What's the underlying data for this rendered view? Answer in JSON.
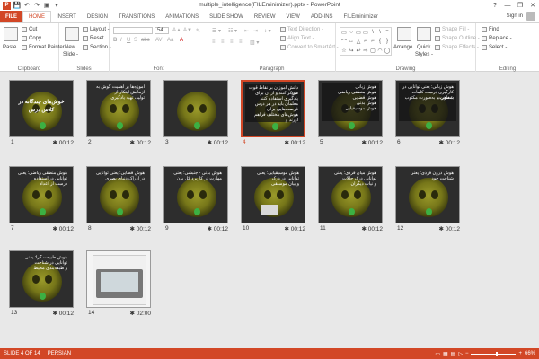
{
  "window": {
    "title": "multiple_intelligence(FILEminimizer).pptx - PowerPoint",
    "help": "?",
    "minimize": "—",
    "restore": "❐",
    "close": "✕"
  },
  "qat": {
    "logo": "P",
    "save": "💾",
    "undo": "↶",
    "redo": "↷",
    "start": "▣",
    "more": "▾"
  },
  "tabs": [
    "HOME",
    "INSERT",
    "DESIGN",
    "TRANSITIONS",
    "ANIMATIONS",
    "SLIDE SHOW",
    "REVIEW",
    "VIEW",
    "ADD-INS",
    "FILEminimizer"
  ],
  "file_tab": "FILE",
  "signin": "Sign in",
  "ribbon": {
    "clipboard": {
      "label": "Clipboard",
      "paste": "Paste",
      "cut": "Cut",
      "copy": "Copy",
      "format_painter": "Format Painter"
    },
    "slides": {
      "label": "Slides",
      "new_slide": "New",
      "new_slide2": "Slide -",
      "layout": "Layout -",
      "reset": "Reset",
      "section": "Section -"
    },
    "font": {
      "label": "Font",
      "size": "54",
      "bold": "B",
      "italic": "I",
      "underline": "U",
      "strike": "S",
      "shadow": "abc",
      "spacing": "AV",
      "case": "Aa",
      "color": "A"
    },
    "paragraph": {
      "label": "Paragraph",
      "text_direction": "Text Direction -",
      "align_text": "Align Text -",
      "convert_smartart": "Convert to SmartArt -"
    },
    "drawing": {
      "label": "Drawing",
      "arrange": "Arrange",
      "quick_styles": "Quick",
      "quick_styles2": "Styles -",
      "shape_fill": "Shape Fill -",
      "shape_outline": "Shape Outline -",
      "shape_effects": "Shape Effects -"
    },
    "editing": {
      "label": "Editing",
      "find": "Find",
      "replace": "Replace -",
      "select": "Select -"
    },
    "shapes": [
      "▭",
      "○",
      "▭",
      "▭",
      "\\",
      "\\",
      "⌒",
      "⌒",
      "↔",
      "△",
      "⌐",
      "⌐",
      "{",
      "}",
      "☆",
      "↪",
      "↩",
      "⇨",
      "▢",
      "◠",
      "◯"
    ]
  },
  "slides": [
    {
      "num": "1",
      "duration": "00:12",
      "lines": [
        "خوش‌های چندگانه در",
        "کلاس درس"
      ],
      "variant": "title"
    },
    {
      "num": "2",
      "duration": "00:12",
      "lines": [
        "آموزه‌ها بر اهمیت گوش به",
        "آزمایش ابتکار از",
        "تولید، تهیه یادگیری"
      ],
      "variant": "mask"
    },
    {
      "num": "3",
      "duration": "00:12",
      "lines": [],
      "variant": "mask"
    },
    {
      "num": "4",
      "duration": "00:12",
      "lines": [
        "دانش آموزان بر نقاط قوت خود",
        "تمرکز کنند و از آن برای",
        "یادگیری استفاده کنند",
        "معلمان باید در هر درس",
        "فرصت‌هایی برای",
        "هوش‌های مختلف فراهم",
        "آورند و"
      ],
      "variant": "text",
      "selected": true
    },
    {
      "num": "5",
      "duration": "00:12",
      "lines": [
        "هوش زبانی",
        "هوش منطقی ریاضی",
        "هوش فضایی",
        "هوش بدنی",
        "هوش موسیقیایی"
      ],
      "variant": "list"
    },
    {
      "num": "6",
      "duration": "00:12",
      "lines": [
        "هوش زبانی: یعنی توانایی در",
        "کارگیری درست کلمات به‌صورت",
        "شفاهی یا به‌صورت مکتوب"
      ],
      "variant": "def"
    },
    {
      "num": "7",
      "duration": "00:12",
      "lines": [
        "هوش منطقی ریاضی: یعنی",
        "توانایی در استفاده",
        "درست از اعداد"
      ],
      "variant": "mask"
    },
    {
      "num": "8",
      "duration": "00:12",
      "lines": [
        "هوش فضایی: یعنی توانایی",
        "در ادراک دنیای بصری"
      ],
      "variant": "mask"
    },
    {
      "num": "9",
      "duration": "00:12",
      "lines": [
        "هوش بدنی - جنبشی: یعنی",
        "مهارت در کاربرد کل بدن"
      ],
      "variant": "mask"
    },
    {
      "num": "10",
      "duration": "00:12",
      "lines": [
        "هوش موسیقیایی: یعنی",
        "توانایی در درک",
        "و بیان موسیقی"
      ],
      "variant": "mask",
      "photo": true
    },
    {
      "num": "11",
      "duration": "00:12",
      "lines": [
        "هوش میان فردی: یعنی",
        "توانایی درک حالات",
        "و نیات دیگران"
      ],
      "variant": "mask"
    },
    {
      "num": "12",
      "duration": "00:12",
      "lines": [
        "هوش درون فردی: یعنی",
        "شناخت خود"
      ],
      "variant": "mask"
    },
    {
      "num": "13",
      "duration": "00:12",
      "lines": [
        "هوش طبیعت گرا: یعنی",
        "توانایی در شناخت",
        "و طبقه‌بندی محیط"
      ],
      "variant": "mask"
    },
    {
      "num": "14",
      "duration": "02:00",
      "lines": [],
      "variant": "web"
    }
  ],
  "status": {
    "slide": "SLIDE 4 OF 14",
    "language": "PERSIAN",
    "zoom": "66%"
  }
}
